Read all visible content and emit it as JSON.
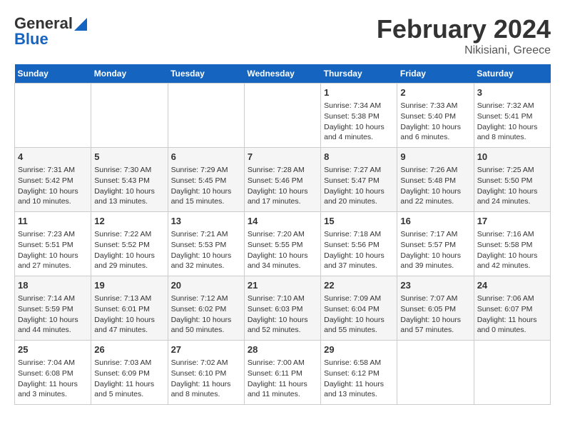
{
  "logo": {
    "general": "General",
    "blue": "Blue"
  },
  "title": {
    "month": "February 2024",
    "location": "Nikisiani, Greece"
  },
  "days_of_week": [
    "Sunday",
    "Monday",
    "Tuesday",
    "Wednesday",
    "Thursday",
    "Friday",
    "Saturday"
  ],
  "weeks": [
    [
      {
        "num": "",
        "info": ""
      },
      {
        "num": "",
        "info": ""
      },
      {
        "num": "",
        "info": ""
      },
      {
        "num": "",
        "info": ""
      },
      {
        "num": "1",
        "info": "Sunrise: 7:34 AM\nSunset: 5:38 PM\nDaylight: 10 hours\nand 4 minutes."
      },
      {
        "num": "2",
        "info": "Sunrise: 7:33 AM\nSunset: 5:40 PM\nDaylight: 10 hours\nand 6 minutes."
      },
      {
        "num": "3",
        "info": "Sunrise: 7:32 AM\nSunset: 5:41 PM\nDaylight: 10 hours\nand 8 minutes."
      }
    ],
    [
      {
        "num": "4",
        "info": "Sunrise: 7:31 AM\nSunset: 5:42 PM\nDaylight: 10 hours\nand 10 minutes."
      },
      {
        "num": "5",
        "info": "Sunrise: 7:30 AM\nSunset: 5:43 PM\nDaylight: 10 hours\nand 13 minutes."
      },
      {
        "num": "6",
        "info": "Sunrise: 7:29 AM\nSunset: 5:45 PM\nDaylight: 10 hours\nand 15 minutes."
      },
      {
        "num": "7",
        "info": "Sunrise: 7:28 AM\nSunset: 5:46 PM\nDaylight: 10 hours\nand 17 minutes."
      },
      {
        "num": "8",
        "info": "Sunrise: 7:27 AM\nSunset: 5:47 PM\nDaylight: 10 hours\nand 20 minutes."
      },
      {
        "num": "9",
        "info": "Sunrise: 7:26 AM\nSunset: 5:48 PM\nDaylight: 10 hours\nand 22 minutes."
      },
      {
        "num": "10",
        "info": "Sunrise: 7:25 AM\nSunset: 5:50 PM\nDaylight: 10 hours\nand 24 minutes."
      }
    ],
    [
      {
        "num": "11",
        "info": "Sunrise: 7:23 AM\nSunset: 5:51 PM\nDaylight: 10 hours\nand 27 minutes."
      },
      {
        "num": "12",
        "info": "Sunrise: 7:22 AM\nSunset: 5:52 PM\nDaylight: 10 hours\nand 29 minutes."
      },
      {
        "num": "13",
        "info": "Sunrise: 7:21 AM\nSunset: 5:53 PM\nDaylight: 10 hours\nand 32 minutes."
      },
      {
        "num": "14",
        "info": "Sunrise: 7:20 AM\nSunset: 5:55 PM\nDaylight: 10 hours\nand 34 minutes."
      },
      {
        "num": "15",
        "info": "Sunrise: 7:18 AM\nSunset: 5:56 PM\nDaylight: 10 hours\nand 37 minutes."
      },
      {
        "num": "16",
        "info": "Sunrise: 7:17 AM\nSunset: 5:57 PM\nDaylight: 10 hours\nand 39 minutes."
      },
      {
        "num": "17",
        "info": "Sunrise: 7:16 AM\nSunset: 5:58 PM\nDaylight: 10 hours\nand 42 minutes."
      }
    ],
    [
      {
        "num": "18",
        "info": "Sunrise: 7:14 AM\nSunset: 5:59 PM\nDaylight: 10 hours\nand 44 minutes."
      },
      {
        "num": "19",
        "info": "Sunrise: 7:13 AM\nSunset: 6:01 PM\nDaylight: 10 hours\nand 47 minutes."
      },
      {
        "num": "20",
        "info": "Sunrise: 7:12 AM\nSunset: 6:02 PM\nDaylight: 10 hours\nand 50 minutes."
      },
      {
        "num": "21",
        "info": "Sunrise: 7:10 AM\nSunset: 6:03 PM\nDaylight: 10 hours\nand 52 minutes."
      },
      {
        "num": "22",
        "info": "Sunrise: 7:09 AM\nSunset: 6:04 PM\nDaylight: 10 hours\nand 55 minutes."
      },
      {
        "num": "23",
        "info": "Sunrise: 7:07 AM\nSunset: 6:05 PM\nDaylight: 10 hours\nand 57 minutes."
      },
      {
        "num": "24",
        "info": "Sunrise: 7:06 AM\nSunset: 6:07 PM\nDaylight: 11 hours\nand 0 minutes."
      }
    ],
    [
      {
        "num": "25",
        "info": "Sunrise: 7:04 AM\nSunset: 6:08 PM\nDaylight: 11 hours\nand 3 minutes."
      },
      {
        "num": "26",
        "info": "Sunrise: 7:03 AM\nSunset: 6:09 PM\nDaylight: 11 hours\nand 5 minutes."
      },
      {
        "num": "27",
        "info": "Sunrise: 7:02 AM\nSunset: 6:10 PM\nDaylight: 11 hours\nand 8 minutes."
      },
      {
        "num": "28",
        "info": "Sunrise: 7:00 AM\nSunset: 6:11 PM\nDaylight: 11 hours\nand 11 minutes."
      },
      {
        "num": "29",
        "info": "Sunrise: 6:58 AM\nSunset: 6:12 PM\nDaylight: 11 hours\nand 13 minutes."
      },
      {
        "num": "",
        "info": ""
      },
      {
        "num": "",
        "info": ""
      }
    ]
  ]
}
